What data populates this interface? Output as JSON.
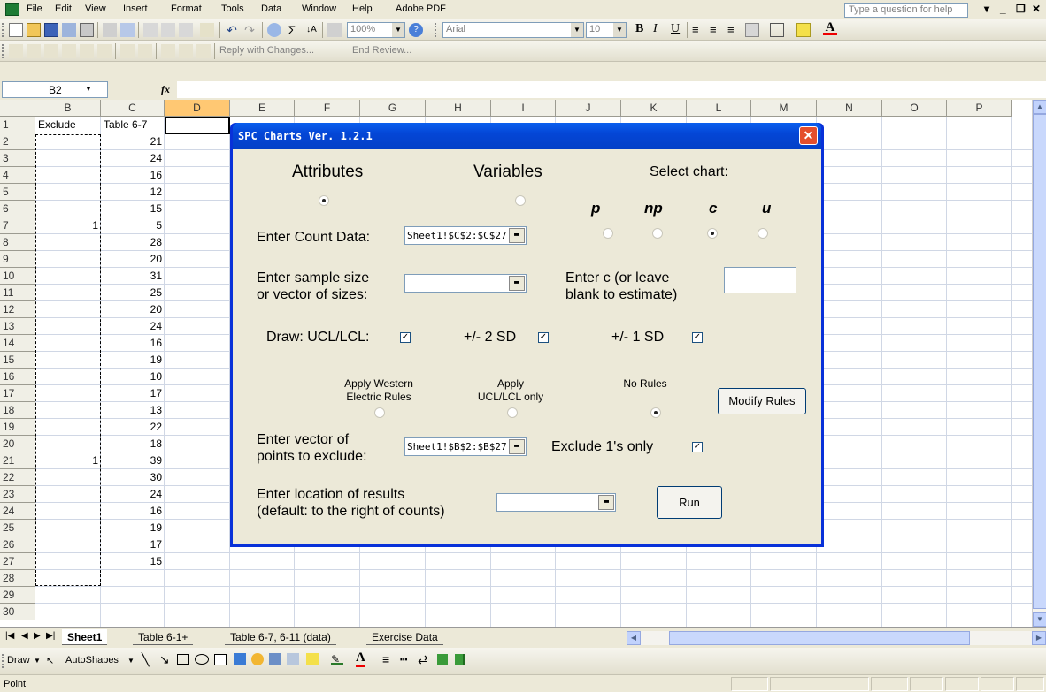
{
  "menu": {
    "items": [
      "File",
      "Edit",
      "View",
      "Insert",
      "Format",
      "Tools",
      "Data",
      "Window",
      "Help",
      "Adobe PDF"
    ],
    "help_placeholder": "Type a question for help"
  },
  "toolbar": {
    "zoom": "100%",
    "font": "Arial",
    "font_size": "10",
    "reviewing": {
      "reply_label": "Reply with Changes...",
      "end_review_label": "End Review..."
    }
  },
  "formula_bar": {
    "name_box": "B2",
    "fx": "fx",
    "formula": ""
  },
  "sheet": {
    "columns": [
      "B",
      "C",
      "D",
      "E",
      "F",
      "G",
      "H",
      "I",
      "J",
      "K",
      "L",
      "M",
      "N",
      "O",
      "P"
    ],
    "selected_column": "D",
    "rows": [
      "1",
      "2",
      "3",
      "4",
      "5",
      "6",
      "7",
      "8",
      "9",
      "10",
      "11",
      "12",
      "13",
      "14",
      "15",
      "16",
      "17",
      "18",
      "19",
      "20",
      "21",
      "22",
      "23",
      "24",
      "25",
      "26",
      "27",
      "28",
      "29",
      "30"
    ],
    "header_b": "Exclude",
    "header_c": "Table 6-7",
    "col_c_values": [
      "21",
      "24",
      "16",
      "12",
      "15",
      "5",
      "28",
      "20",
      "31",
      "25",
      "20",
      "24",
      "16",
      "19",
      "10",
      "17",
      "13",
      "22",
      "18",
      "39",
      "30",
      "24",
      "16",
      "19",
      "17",
      "15"
    ],
    "col_b_values": [
      {
        "row": "7",
        "value": "1"
      },
      {
        "row": "21",
        "value": "1"
      }
    ]
  },
  "tabs": {
    "items": [
      "Sheet1",
      "Table 6-1+",
      "Table 6-7, 6-11 (data)",
      "Exercise Data"
    ],
    "active": "Sheet1"
  },
  "drawbar": {
    "draw_label": "Draw",
    "autoshapes_label": "AutoShapes"
  },
  "status": {
    "text": "Point"
  },
  "dialog": {
    "title": "SPC Charts Ver. 1.2.1",
    "attributes_label": "Attributes",
    "variables_label": "Variables",
    "select_chart_label": "Select chart:",
    "chart_types": [
      "p",
      "np",
      "c",
      "u"
    ],
    "selected_chart": "c",
    "count_data_label": "Enter Count Data:",
    "count_data_value": "Sheet1!$C$2:$C$27",
    "sample_size_label_1": "Enter sample size",
    "sample_size_label_2": "or vector of sizes:",
    "sample_size_value": "",
    "c_label_1": "Enter c (or leave",
    "c_label_2": "blank to estimate)",
    "c_value": "",
    "draw_ucl_lcl_label": "Draw: UCL/LCL:",
    "two_sd_label": "+/- 2 SD",
    "one_sd_label": "+/- 1 SD",
    "western_label_1": "Apply Western",
    "western_label_2": "Electric Rules",
    "ucl_only_label_1": "Apply",
    "ucl_only_label_2": "UCL/LCL only",
    "no_rules_label": "No Rules",
    "modify_rules_label": "Modify Rules",
    "exclude_label_1": "Enter vector of",
    "exclude_label_2": "points to exclude:",
    "exclude_value": "Sheet1!$B$2:$B$27",
    "exclude_ones_label": "Exclude 1's only",
    "results_label_1": "Enter location of results",
    "results_label_2": "(default: to the right of counts)",
    "results_value": "",
    "run_label": "Run"
  },
  "colors": {
    "titlebar": "#0446d6",
    "close": "#e44e2c",
    "dialog_bg": "#ece9d8",
    "selected_header": "#ffc873"
  }
}
